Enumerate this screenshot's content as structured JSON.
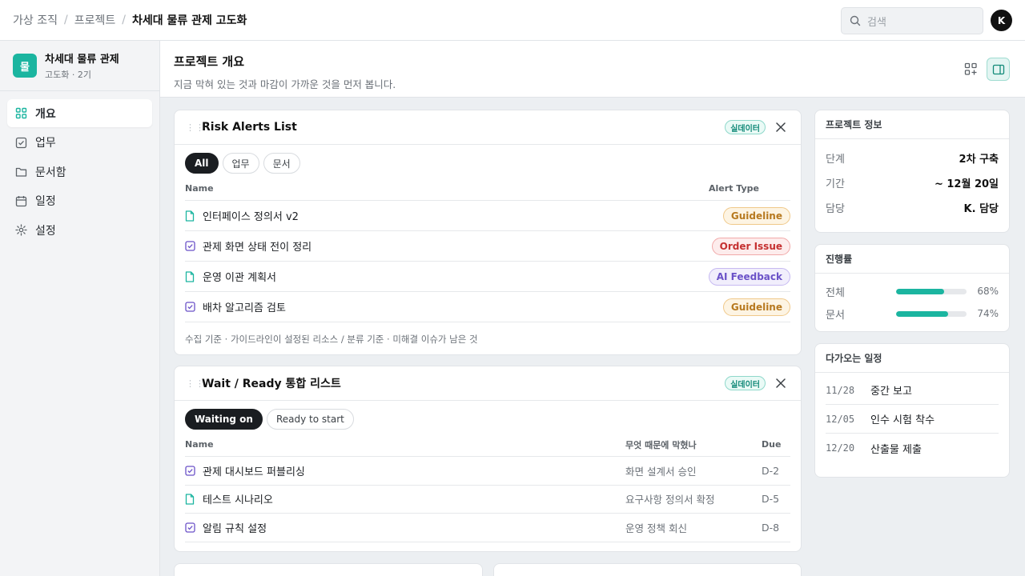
{
  "breadcrumb": [
    "가상 조직",
    "프로젝트",
    "차세대 물류 관제 고도화"
  ],
  "search": {
    "placeholder": "검색"
  },
  "user": {
    "initial": "K"
  },
  "project": {
    "logo_char": "물",
    "name": "차세대 물류 관제",
    "sub": "고도화 · 2기"
  },
  "nav": [
    {
      "label": "개요",
      "icon": "grid-icon",
      "active": true
    },
    {
      "label": "업무",
      "icon": "checkbox-icon"
    },
    {
      "label": "문서함",
      "icon": "folder-icon"
    },
    {
      "label": "일정",
      "icon": "calendar-icon"
    },
    {
      "label": "설정",
      "icon": "gear-icon"
    }
  ],
  "header": {
    "title": "프로젝트 개요",
    "subtitle": "지금 막혀 있는 것과 마감이 가까운 것을 먼저 봅니다."
  },
  "risk": {
    "title": "Risk Alerts List",
    "live_badge": "실데이터",
    "filters": [
      "All",
      "업무",
      "문서"
    ],
    "columns": [
      "Name",
      "Alert Type"
    ],
    "rows": [
      {
        "icon": "doc",
        "name": "인터페이스 정의서 v2",
        "tag": "Guideline"
      },
      {
        "icon": "task",
        "name": "관제 화면 상태 전이 정리",
        "tag": "Order Issue"
      },
      {
        "icon": "doc",
        "name": "운영 이관 계획서",
        "tag": "AI Feedback"
      },
      {
        "icon": "task",
        "name": "배차 알고리즘 검토",
        "tag": "Guideline"
      }
    ],
    "footnote": "수집 기준 · 가이드라인이 설정된 리소스 / 분류 기준 · 미해결 이슈가 남은 것"
  },
  "tag_colors": {
    "Guideline": {
      "fg": "#b7791f",
      "bg": "#fdf4e3",
      "border": "#f0c98a"
    },
    "Order Issue": {
      "fg": "#c53030",
      "bg": "#fdecec",
      "border": "#f1a9a9"
    },
    "AI Feedback": {
      "fg": "#6b52c8",
      "bg": "#f1eefc",
      "border": "#c6b9f1"
    }
  },
  "wait": {
    "title": "Wait / Ready 통합 리스트",
    "live_badge": "실데이터",
    "filters": [
      "Waiting on",
      "Ready to start"
    ],
    "columns": [
      "Name",
      "무엇 때문에 막혔나",
      "Due"
    ],
    "rows": [
      {
        "icon": "task",
        "name": "관제 대시보드 퍼블리싱",
        "blocker": "화면 설계서 승인",
        "due": "D-2"
      },
      {
        "icon": "doc",
        "name": "테스트 시나리오",
        "blocker": "요구사항 정의서 확정",
        "due": "D-5"
      },
      {
        "icon": "task",
        "name": "알림 규칙 설정",
        "blocker": "운영 정책 회신",
        "due": "D-8"
      }
    ]
  },
  "info": {
    "title": "프로젝트 정보",
    "rows": [
      {
        "k": "단계",
        "v": "2차 구축"
      },
      {
        "k": "기간",
        "v": "~ 12월 20일"
      },
      {
        "k": "담당",
        "v": "K. 담당"
      }
    ]
  },
  "progress": {
    "title": "진행률",
    "rows": [
      {
        "k": "전체",
        "value": 68,
        "label": "68%"
      },
      {
        "k": "문서",
        "value": 74,
        "label": "74%"
      }
    ]
  },
  "schedule": {
    "title": "다가오는 일정",
    "rows": [
      {
        "d": "11/28",
        "t": "중간 보고"
      },
      {
        "d": "12/05",
        "t": "인수 시험 착수"
      },
      {
        "d": "12/20",
        "t": "산출물 제출"
      }
    ]
  }
}
